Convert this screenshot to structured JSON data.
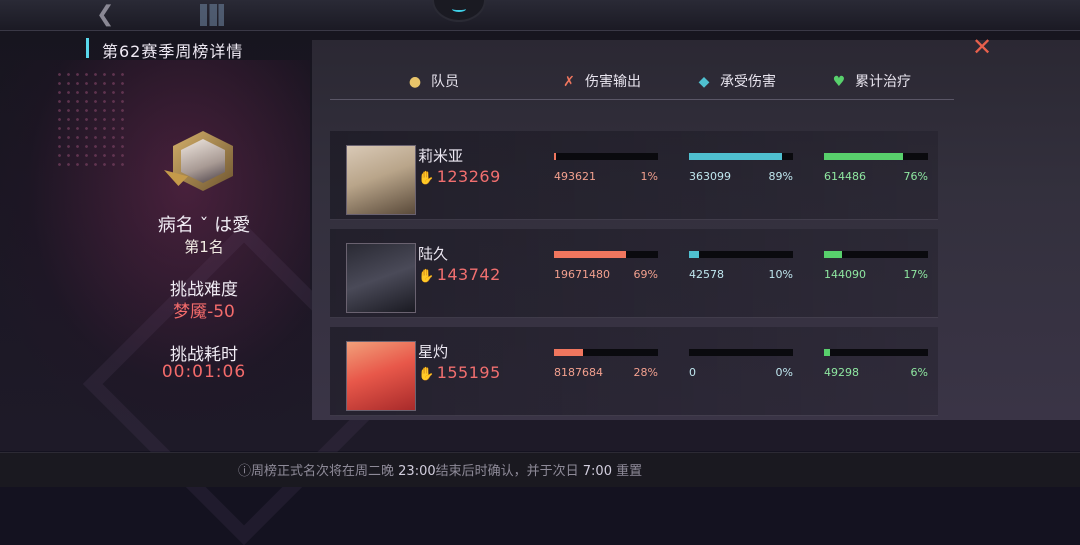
{
  "window": {
    "title": "第62赛季周榜详情"
  },
  "player": {
    "name": "病名 ˇ は愛",
    "rank": "第1名",
    "difficulty_label": "挑战难度",
    "difficulty_value": "梦魇-50",
    "time_label": "挑战耗时",
    "time_value": "00:01:06"
  },
  "columns": [
    {
      "label": "队员",
      "icon": "member-icon"
    },
    {
      "label": "伤害输出",
      "icon": "damage-icon"
    },
    {
      "label": "承受伤害",
      "icon": "shield-icon"
    },
    {
      "label": "累计治疗",
      "icon": "heal-icon"
    }
  ],
  "colors": {
    "damage": "#f0765e",
    "taken": "#4fc0d0",
    "heal": "#58d06c",
    "power": "#f16f6f",
    "accent": "#59d8ec"
  },
  "members": [
    {
      "name": "莉米亚",
      "power": "123269",
      "damage": "493621",
      "damage_pct": "1%",
      "damage_frac": 0.01,
      "taken": "363099",
      "taken_pct": "89%",
      "taken_frac": 0.89,
      "heal": "614486",
      "heal_pct": "76%",
      "heal_frac": 0.76
    },
    {
      "name": "陆久",
      "power": "143742",
      "damage": "19671480",
      "damage_pct": "69%",
      "damage_frac": 0.69,
      "taken": "42578",
      "taken_pct": "10%",
      "taken_frac": 0.1,
      "heal": "144090",
      "heal_pct": "17%",
      "heal_frac": 0.17
    },
    {
      "name": "星灼",
      "power": "155195",
      "damage": "8187684",
      "damage_pct": "28%",
      "damage_frac": 0.28,
      "taken": "0",
      "taken_pct": "0%",
      "taken_frac": 0.0,
      "heal": "49298",
      "heal_pct": "6%",
      "heal_frac": 0.06
    }
  ],
  "footer": {
    "prefix": "周榜正式名次将在周二晚 ",
    "time1": "23:00",
    "middle": "结束后时确认，并于次日 ",
    "time2": "7:00",
    "suffix": " 重置"
  }
}
